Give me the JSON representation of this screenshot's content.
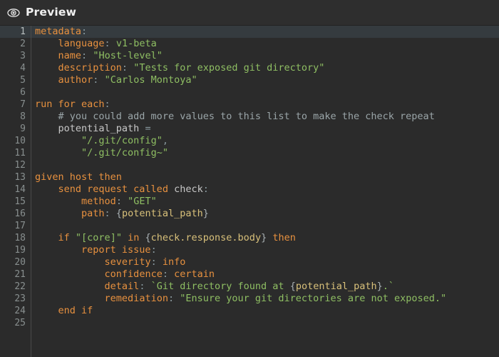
{
  "header": {
    "title": "Preview",
    "icon": "eye-icon"
  },
  "colors": {
    "background": "#2b2b2b",
    "header_background": "#2e2e2e",
    "active_line_background": "#353b3f",
    "gutter_text": "#888f8f",
    "keyword": "#e8913f",
    "string": "#8fbf63",
    "comment": "#9aa5a8",
    "interpolation": "#d8c07a",
    "punctuation": "#8a9aa0",
    "plain_text": "#d4d4d4"
  },
  "editor": {
    "active_line": 1,
    "total_lines": 25,
    "lines": [
      {
        "num": "1",
        "text": "metadata:"
      },
      {
        "num": "2",
        "text": "    language: v1-beta"
      },
      {
        "num": "3",
        "text": "    name: \"Host-level\""
      },
      {
        "num": "4",
        "text": "    description: \"Tests for exposed git directory\""
      },
      {
        "num": "5",
        "text": "    author: \"Carlos Montoya\""
      },
      {
        "num": "6",
        "text": ""
      },
      {
        "num": "7",
        "text": "run for each:"
      },
      {
        "num": "8",
        "text": "    # you could add more values to this list to make the check repeat"
      },
      {
        "num": "9",
        "text": "    potential_path ="
      },
      {
        "num": "10",
        "text": "        \"/.git/config\","
      },
      {
        "num": "11",
        "text": "        \"/.git/config~\""
      },
      {
        "num": "12",
        "text": ""
      },
      {
        "num": "13",
        "text": "given host then"
      },
      {
        "num": "14",
        "text": "    send request called check:"
      },
      {
        "num": "15",
        "text": "        method: \"GET\""
      },
      {
        "num": "16",
        "text": "        path: {potential_path}"
      },
      {
        "num": "17",
        "text": ""
      },
      {
        "num": "18",
        "text": "    if \"[core]\" in {check.response.body} then"
      },
      {
        "num": "19",
        "text": "        report issue:"
      },
      {
        "num": "20",
        "text": "            severity: info"
      },
      {
        "num": "21",
        "text": "            confidence: certain"
      },
      {
        "num": "22",
        "text": "            detail: `Git directory found at {potential_path}.`"
      },
      {
        "num": "23",
        "text": "            remediation: \"Ensure your git directories are not exposed.\""
      },
      {
        "num": "24",
        "text": "    end if"
      },
      {
        "num": "25",
        "text": ""
      }
    ],
    "tokens": [
      [
        {
          "t": "metadata",
          "c": "k"
        },
        {
          "t": ":",
          "c": "p"
        }
      ],
      [
        {
          "t": "    ",
          "c": "t"
        },
        {
          "t": "language",
          "c": "k"
        },
        {
          "t": ":",
          "c": "p"
        },
        {
          "t": " ",
          "c": "t"
        },
        {
          "t": "v1-beta",
          "c": "s"
        }
      ],
      [
        {
          "t": "    ",
          "c": "t"
        },
        {
          "t": "name",
          "c": "k"
        },
        {
          "t": ":",
          "c": "p"
        },
        {
          "t": " ",
          "c": "t"
        },
        {
          "t": "\"Host-level\"",
          "c": "s"
        }
      ],
      [
        {
          "t": "    ",
          "c": "t"
        },
        {
          "t": "description",
          "c": "k"
        },
        {
          "t": ":",
          "c": "p"
        },
        {
          "t": " ",
          "c": "t"
        },
        {
          "t": "\"Tests for exposed git directory\"",
          "c": "s"
        }
      ],
      [
        {
          "t": "    ",
          "c": "t"
        },
        {
          "t": "author",
          "c": "k"
        },
        {
          "t": ":",
          "c": "p"
        },
        {
          "t": " ",
          "c": "t"
        },
        {
          "t": "\"Carlos Montoya\"",
          "c": "s"
        }
      ],
      [],
      [
        {
          "t": "run for each",
          "c": "k"
        },
        {
          "t": ":",
          "c": "p"
        }
      ],
      [
        {
          "t": "    ",
          "c": "t"
        },
        {
          "t": "# you could add more values to this list to make the check repeat",
          "c": "c"
        }
      ],
      [
        {
          "t": "    ",
          "c": "t"
        },
        {
          "t": "potential_path",
          "c": "n"
        },
        {
          "t": " ",
          "c": "t"
        },
        {
          "t": "=",
          "c": "p"
        }
      ],
      [
        {
          "t": "        ",
          "c": "t"
        },
        {
          "t": "\"/.git/config\"",
          "c": "s"
        },
        {
          "t": ",",
          "c": "p"
        }
      ],
      [
        {
          "t": "        ",
          "c": "t"
        },
        {
          "t": "\"/.git/config~\"",
          "c": "s"
        }
      ],
      [],
      [
        {
          "t": "given host then",
          "c": "k"
        }
      ],
      [
        {
          "t": "    ",
          "c": "t"
        },
        {
          "t": "send request called",
          "c": "k"
        },
        {
          "t": " ",
          "c": "t"
        },
        {
          "t": "check",
          "c": "n"
        },
        {
          "t": ":",
          "c": "p"
        }
      ],
      [
        {
          "t": "        ",
          "c": "t"
        },
        {
          "t": "method",
          "c": "k"
        },
        {
          "t": ":",
          "c": "p"
        },
        {
          "t": " ",
          "c": "t"
        },
        {
          "t": "\"GET\"",
          "c": "s"
        }
      ],
      [
        {
          "t": "        ",
          "c": "t"
        },
        {
          "t": "path",
          "c": "k"
        },
        {
          "t": ":",
          "c": "p"
        },
        {
          "t": " ",
          "c": "t"
        },
        {
          "t": "{",
          "c": "b"
        },
        {
          "t": "potential_path",
          "c": "v"
        },
        {
          "t": "}",
          "c": "b"
        }
      ],
      [],
      [
        {
          "t": "    ",
          "c": "t"
        },
        {
          "t": "if",
          "c": "k"
        },
        {
          "t": " ",
          "c": "t"
        },
        {
          "t": "\"[core]\"",
          "c": "s"
        },
        {
          "t": " ",
          "c": "t"
        },
        {
          "t": "in",
          "c": "k"
        },
        {
          "t": " ",
          "c": "t"
        },
        {
          "t": "{",
          "c": "b"
        },
        {
          "t": "check.response.body",
          "c": "v"
        },
        {
          "t": "}",
          "c": "b"
        },
        {
          "t": " ",
          "c": "t"
        },
        {
          "t": "then",
          "c": "k"
        }
      ],
      [
        {
          "t": "        ",
          "c": "t"
        },
        {
          "t": "report issue",
          "c": "k"
        },
        {
          "t": ":",
          "c": "p"
        }
      ],
      [
        {
          "t": "            ",
          "c": "t"
        },
        {
          "t": "severity",
          "c": "k"
        },
        {
          "t": ":",
          "c": "p"
        },
        {
          "t": " ",
          "c": "t"
        },
        {
          "t": "info",
          "c": "k"
        }
      ],
      [
        {
          "t": "            ",
          "c": "t"
        },
        {
          "t": "confidence",
          "c": "k"
        },
        {
          "t": ":",
          "c": "p"
        },
        {
          "t": " ",
          "c": "t"
        },
        {
          "t": "certain",
          "c": "k"
        }
      ],
      [
        {
          "t": "            ",
          "c": "t"
        },
        {
          "t": "detail",
          "c": "k"
        },
        {
          "t": ":",
          "c": "p"
        },
        {
          "t": " ",
          "c": "t"
        },
        {
          "t": "`Git directory found at ",
          "c": "s"
        },
        {
          "t": "{",
          "c": "b"
        },
        {
          "t": "potential_path",
          "c": "v"
        },
        {
          "t": "}",
          "c": "b"
        },
        {
          "t": ".`",
          "c": "s"
        }
      ],
      [
        {
          "t": "            ",
          "c": "t"
        },
        {
          "t": "remediation",
          "c": "k"
        },
        {
          "t": ":",
          "c": "p"
        },
        {
          "t": " ",
          "c": "t"
        },
        {
          "t": "\"Ensure your git directories are not exposed.\"",
          "c": "s"
        }
      ],
      [
        {
          "t": "    ",
          "c": "t"
        },
        {
          "t": "end if",
          "c": "k"
        }
      ],
      []
    ]
  }
}
